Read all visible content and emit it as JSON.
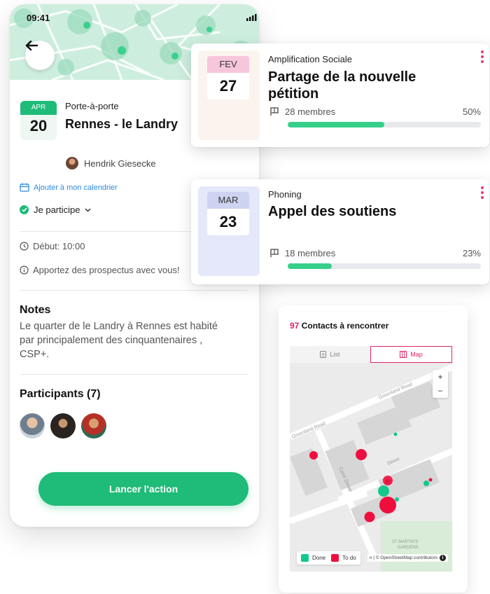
{
  "phone": {
    "status_time": "09:41",
    "event": {
      "month": "APR",
      "day": "20",
      "type": "Porte-à-porte",
      "title": "Rennes - le Landry",
      "organizer": "Hendrik Giesecke",
      "calendar_link": "Ajouter à mon calendrier",
      "participate": "Je participe",
      "start": "Début: 10:00",
      "reminder": "Apportez des prospectus avec vous!"
    },
    "notes": {
      "title": "Notes",
      "text": "Le quarter de le Landry à Rennes est habité par principalement des cinquantenaires , CSP+."
    },
    "participants": {
      "title": "Participants (7)"
    },
    "action_button": "Lancer l'action"
  },
  "cards": [
    {
      "month": "FEV",
      "day": "27",
      "type": "Amplification Sociale",
      "title": "Partage de la nouvelle pétition",
      "members": "28 membres",
      "percent_label": "50%",
      "progress": 0.5,
      "date_bg": "#fbf4ee",
      "month_bg": "#f8c6dc"
    },
    {
      "month": "MAR",
      "day": "23",
      "type": "Phoning",
      "title": "Appel des soutiens",
      "members": "18 membres",
      "percent_label": "23%",
      "progress": 0.23,
      "date_bg": "#e5e8fa",
      "month_bg": "#cdd3f0"
    }
  ],
  "map": {
    "count": "97",
    "title": "Contacts à rencontrer",
    "list_tab": "List",
    "map_tab": "Map",
    "zoom_in": "+",
    "zoom_out": "−",
    "legend_done": "Done",
    "legend_todo": "To do",
    "streets": [
      "Greenland Road",
      "Greenland Road",
      "Carol Street",
      "Street"
    ],
    "park_label": "ST MARTIN'S GARDENS",
    "attribution": "n | © OpenStreetMap contributors",
    "info": "i"
  },
  "colors": {
    "brand_green": "#1fbb78",
    "accent_pink": "#e0245e",
    "link_blue": "#2c8be0",
    "done": "#12c98a",
    "todo": "#ef0f3e"
  }
}
